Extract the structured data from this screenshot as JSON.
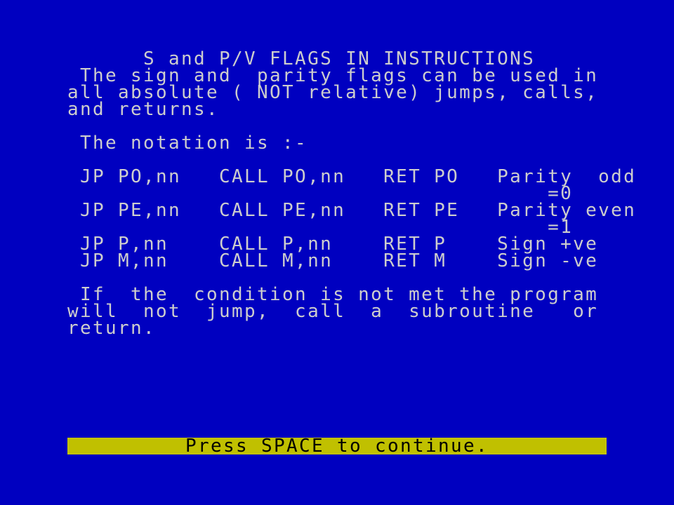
{
  "colors": {
    "background": "#0000c0",
    "text": "#cdcdcd",
    "footer_background": "#c0c000",
    "footer_text": "#000000"
  },
  "title": "      S and P/V FLAGS IN INSTRUCTIONS",
  "intro": [
    " The sign and  parity flags can be used in",
    "all absolute ( NOT relative) jumps, calls,",
    "and returns."
  ],
  "notation_heading": " The notation is :-",
  "table": [
    " JP PO,nn   CALL PO,nn   RET PO   Parity  odd",
    "                                      =0",
    " JP PE,nn   CALL PE,nn   RET PE   Parity even",
    "                                      =1",
    " JP P,nn    CALL P,nn    RET P    Sign +ve",
    " JP M,nn    CALL M,nn    RET M    Sign -ve"
  ],
  "conclusion": [
    " If  the  condition is not met the program",
    "will  not  jump,  call  a  subroutine   or",
    "return."
  ],
  "footer": "Press SPACE to continue."
}
